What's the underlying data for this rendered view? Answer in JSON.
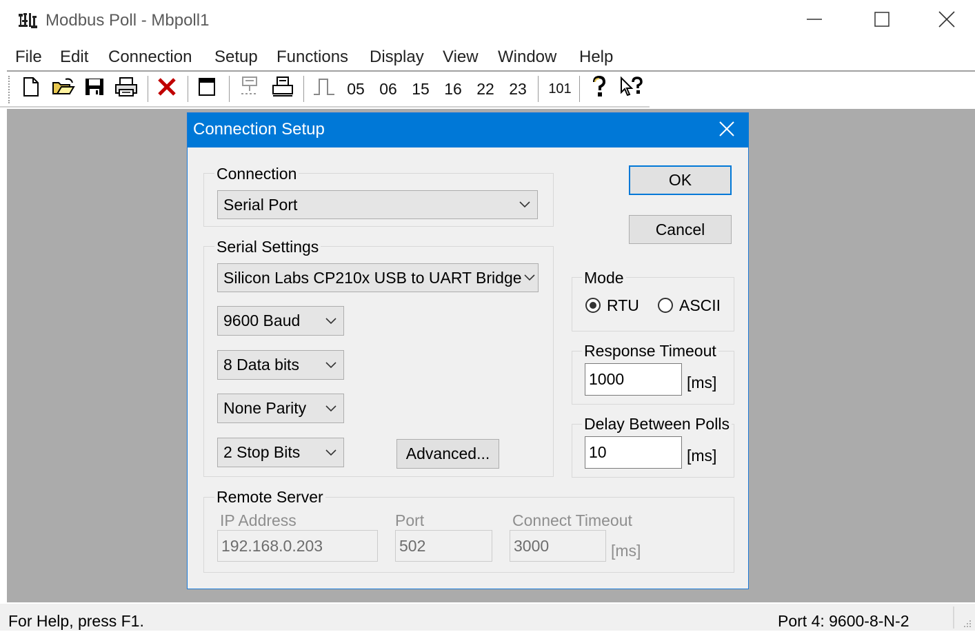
{
  "window": {
    "title": "Modbus Poll - Mbpoll1",
    "minimize_icon": "minimize-icon",
    "maximize_icon": "maximize-icon",
    "close_icon": "close-icon"
  },
  "menu": [
    "File",
    "Edit",
    "Connection",
    "Setup",
    "Functions",
    "Display",
    "View",
    "Window",
    "Help"
  ],
  "toolbar": {
    "icons": [
      "new-document-icon",
      "open-folder-icon",
      "save-icon",
      "print-icon",
      "delete-icon",
      "window-icon",
      "communication-traffic-icon",
      "print-preview-icon",
      "pulse-icon"
    ],
    "function_codes": [
      "05",
      "06",
      "15",
      "16",
      "22",
      "23"
    ],
    "code_101": "101",
    "help_icons": [
      "help-icon",
      "context-help-icon"
    ]
  },
  "dialog": {
    "title": "Connection Setup",
    "connection": {
      "label": "Connection",
      "value": "Serial Port"
    },
    "serial_settings": {
      "label": "Serial Settings",
      "port": "Silicon Labs CP210x USB to UART Bridge",
      "baud": "9600 Baud",
      "data_bits": "8 Data bits",
      "parity": "None Parity",
      "stop_bits": "2 Stop Bits",
      "advanced_label": "Advanced..."
    },
    "ok_label": "OK",
    "cancel_label": "Cancel",
    "mode": {
      "label": "Mode",
      "options": [
        "RTU",
        "ASCII"
      ],
      "selected": "RTU"
    },
    "response_timeout": {
      "label": "Response Timeout",
      "value": "1000",
      "unit": "[ms]"
    },
    "delay_between_polls": {
      "label": "Delay Between Polls",
      "value": "10",
      "unit": "[ms]"
    },
    "remote_server": {
      "label": "Remote Server",
      "ip_label": "IP Address",
      "ip_value": "192.168.0.203",
      "port_label": "Port",
      "port_value": "502",
      "connect_timeout_label": "Connect Timeout",
      "connect_timeout_value": "3000",
      "unit": "[ms]"
    }
  },
  "status": {
    "help_text": "For Help, press F1.",
    "port_text": "Port 4: 9600-8-N-2"
  },
  "colors": {
    "dialog_title_bg": "#0078d7",
    "workspace_bg": "#ababab",
    "dialog_bg": "#f0f0f0",
    "ok_focus_border": "#0078d7"
  }
}
